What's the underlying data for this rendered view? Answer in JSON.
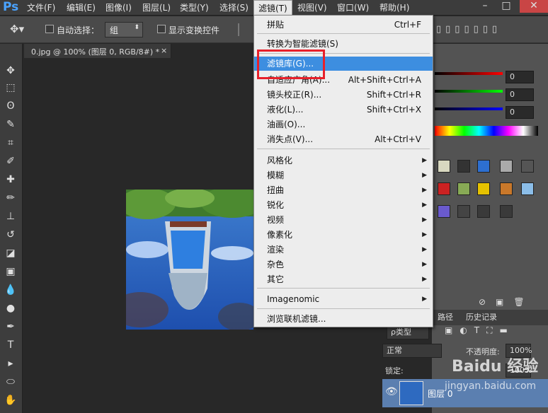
{
  "app": {
    "logo": "Ps"
  },
  "menubar": {
    "items": [
      "文件(F)",
      "编辑(E)",
      "图像(I)",
      "图层(L)",
      "类型(Y)",
      "选择(S)",
      "滤镜(T)",
      "视图(V)",
      "窗口(W)",
      "帮助(H)"
    ],
    "active": "滤镜(T)"
  },
  "options": {
    "auto_select_label": "自动选择：",
    "auto_select_value": "组",
    "show_transform_label": "显示变换控件"
  },
  "document": {
    "tab_title": "0.jpg @ 100% (图层 0, RGB/8#) *",
    "close": "×"
  },
  "filter_menu": {
    "items": [
      {
        "label": "拼贴",
        "shortcut": "Ctrl+F"
      },
      {
        "label": "转换为智能滤镜(S)",
        "shortcut": ""
      },
      {
        "label": "滤镜库(G)...",
        "shortcut": "",
        "highlighted": true
      },
      {
        "label": "自适应广角(A)...",
        "shortcut": "Alt+Shift+Ctrl+A"
      },
      {
        "label": "镜头校正(R)...",
        "shortcut": "Shift+Ctrl+R"
      },
      {
        "label": "液化(L)...",
        "shortcut": "Shift+Ctrl+X"
      },
      {
        "label": "油画(O)...",
        "shortcut": ""
      },
      {
        "label": "消失点(V)...",
        "shortcut": "Alt+Ctrl+V"
      },
      {
        "label": "风格化",
        "submenu": true
      },
      {
        "label": "模糊",
        "submenu": true
      },
      {
        "label": "扭曲",
        "submenu": true
      },
      {
        "label": "锐化",
        "submenu": true
      },
      {
        "label": "视频",
        "submenu": true
      },
      {
        "label": "像素化",
        "submenu": true
      },
      {
        "label": "渲染",
        "submenu": true
      },
      {
        "label": "杂色",
        "submenu": true
      },
      {
        "label": "其它",
        "submenu": true
      },
      {
        "label": "Imagenomic",
        "submenu": true
      },
      {
        "label": "浏览联机滤镜...",
        "shortcut": ""
      }
    ]
  },
  "color_panel": {
    "r": "0",
    "g": "0",
    "b": "0"
  },
  "layers_panel": {
    "tabs": [
      "路径",
      "历史记录"
    ],
    "filter_kind": "ρ类型",
    "blend_mode": "正常",
    "opacity_label": "不透明度:",
    "opacity_value": "100%",
    "lock_label": "锁定:",
    "fill_value": "100%",
    "layer_name": "图层 0"
  },
  "watermark": {
    "text": "Baidu 经验",
    "url": "jingyan.baidu.com"
  },
  "colors": {
    "highlight": "#3d8ee0",
    "annotation_box": "#e8202a"
  }
}
